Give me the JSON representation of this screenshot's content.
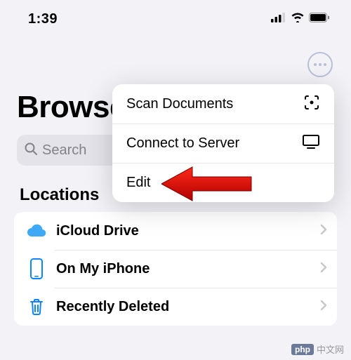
{
  "status": {
    "time": "1:39"
  },
  "ellipsis": {
    "name": "more-options"
  },
  "page": {
    "title": "Browse"
  },
  "search": {
    "placeholder": "Search"
  },
  "menu": {
    "items": [
      {
        "label": "Scan Documents",
        "icon": "viewfinder-icon"
      },
      {
        "label": "Connect to Server",
        "icon": "display-icon"
      },
      {
        "label": "Edit",
        "icon": ""
      }
    ]
  },
  "section": {
    "title": "Locations"
  },
  "locations": {
    "items": [
      {
        "label": "iCloud Drive",
        "icon": "icloud-icon",
        "color": "#3fa9f5"
      },
      {
        "label": "On My iPhone",
        "icon": "iphone-icon",
        "color": "#0a84ff"
      },
      {
        "label": "Recently Deleted",
        "icon": "trash-icon",
        "color": "#0a84ff"
      }
    ]
  },
  "annotation": {
    "target": "Edit"
  },
  "watermark": {
    "text": "中文网",
    "brand": "php"
  }
}
